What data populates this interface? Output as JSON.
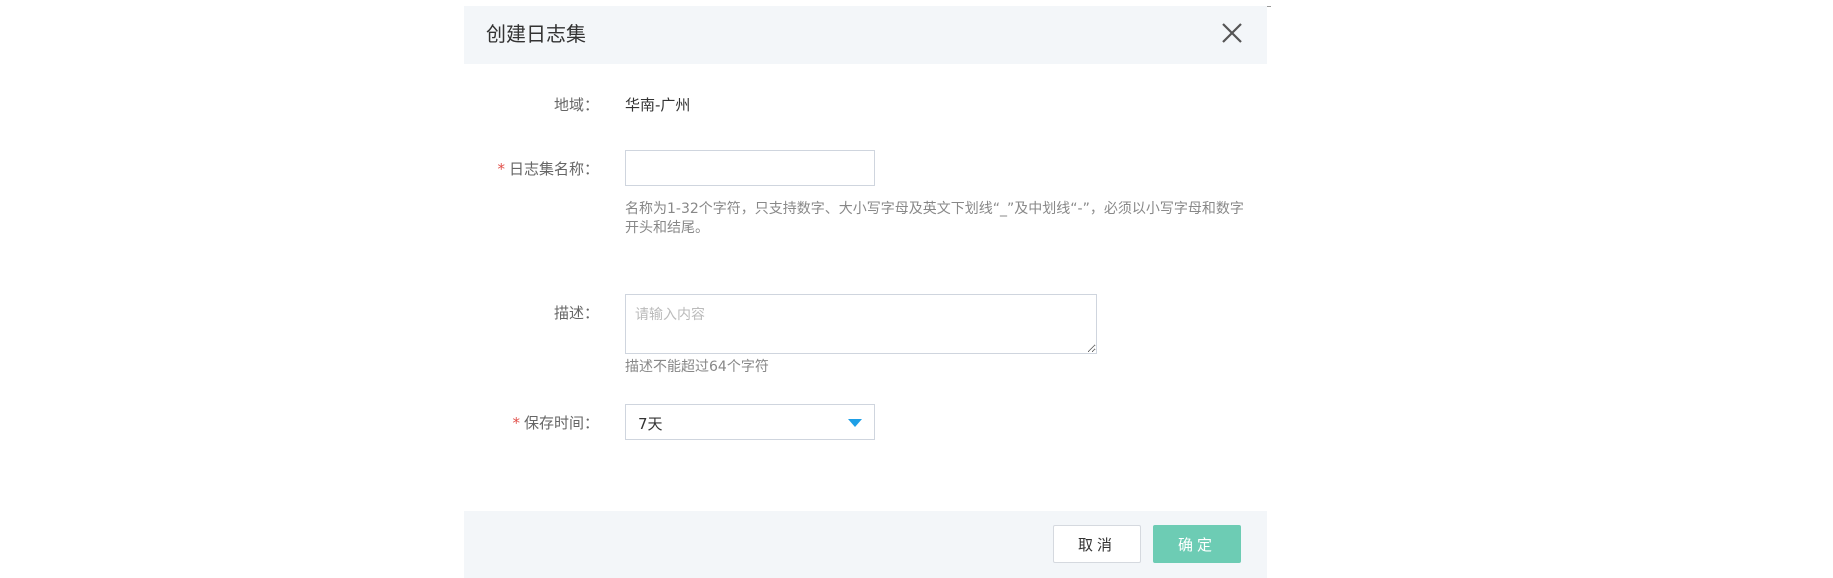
{
  "dialog": {
    "title": "创建日志集",
    "close_icon": "close-icon"
  },
  "form": {
    "region": {
      "label": "地域：",
      "value": "华南-广州"
    },
    "name": {
      "required_mark": "*",
      "label": "日志集名称：",
      "value": "",
      "help": "名称为1-32个字符，只支持数字、大小写字母及英文下划线“_”及中划线“-”，必须以小写字母和数字开头和结尾。"
    },
    "description": {
      "label": "描述：",
      "placeholder": "请输入内容",
      "help": "描述不能超过64个字符"
    },
    "retention": {
      "required_mark": "*",
      "label": "保存时间：",
      "selected": "7天",
      "caret_icon": "caret-down-icon"
    }
  },
  "footer": {
    "cancel_label": "取消",
    "confirm_label": "确定"
  },
  "colors": {
    "header_bg": "#f3f6f9",
    "required": "#e1504a",
    "caret": "#1e9fe6",
    "confirm_bg": "#6dccb4"
  }
}
